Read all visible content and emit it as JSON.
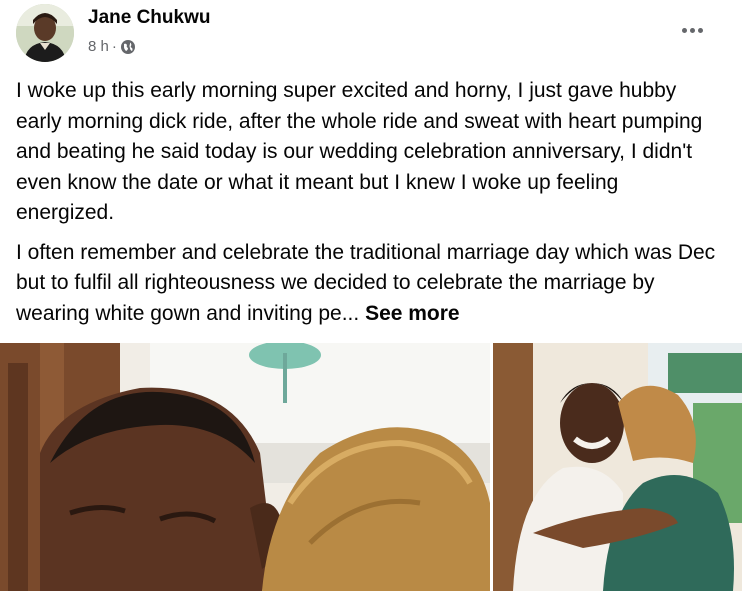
{
  "post": {
    "author": "Jane Chukwu",
    "timestamp": "8 h",
    "separator": "·",
    "privacy_icon": "globe-icon",
    "more_icon": "more-options-icon",
    "paragraphs": [
      "I woke up this early morning super excited and horny, I just gave hubby early morning dick ride, after the whole ride and sweat with heart pumping and beating he said today is our wedding celebration anniversary, I didn't even know the date or what it meant but I knew I woke up feeling energized.",
      "I often remember and celebrate the traditional marriage day which was Dec but to fulfil all righteousness we decided to celebrate the marriage by wearing white gown and inviting pe..."
    ],
    "see_more_label": "See more",
    "photos_count": 2
  },
  "colors": {
    "text": "#050505",
    "secondary": "#65676b",
    "background": "#ffffff"
  }
}
